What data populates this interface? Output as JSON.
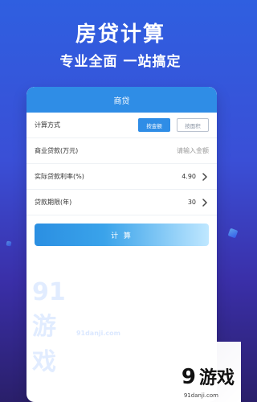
{
  "hero": {
    "title": "房贷计算",
    "subtitle": "专业全面 一站搞定"
  },
  "card": {
    "header": "商贷",
    "rows": [
      {
        "label": "计算方式",
        "options": [
          "按金额",
          "按面积"
        ],
        "selected_index": 0
      },
      {
        "label": "商业贷款(万元)",
        "placeholder": "请输入金额"
      },
      {
        "label": "实际贷款利率(%)",
        "value": "4.90"
      },
      {
        "label": "贷款期限(年)",
        "value": "30"
      }
    ],
    "calculate_label": "计 算"
  },
  "watermark": {
    "left_logo": "91游戏",
    "left_site": "91danji.com",
    "right_logo_num": "9",
    "right_logo_text": "游戏",
    "right_site": "91danji.com"
  },
  "colors": {
    "accent": "#2f8de6",
    "bg_top": "#2f5fe0",
    "bg_bottom": "#2a1f6a"
  }
}
